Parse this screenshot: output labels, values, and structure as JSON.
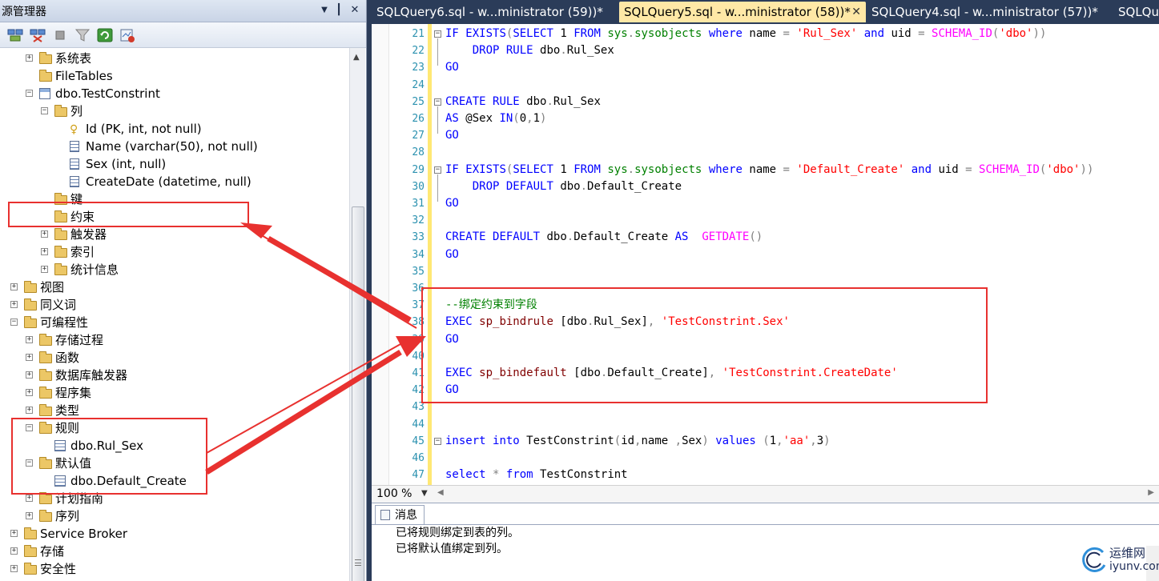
{
  "object_explorer": {
    "title": "源管理器",
    "controls": {
      "dropdown": "▼",
      "pin": "┃",
      "close": "✕"
    },
    "tree": [
      {
        "label": "系统表",
        "expander": "+",
        "icon": "folder"
      },
      {
        "label": "FileTables",
        "expander": "",
        "icon": "folder"
      },
      {
        "label": "dbo.TestConstrint",
        "expander": "−",
        "icon": "table"
      },
      {
        "label": "列",
        "expander": "−",
        "icon": "folder"
      },
      {
        "label": "Id (PK, int, not null)",
        "expander": "",
        "icon": "key"
      },
      {
        "label": "Name (varchar(50), not null)",
        "expander": "",
        "icon": "column"
      },
      {
        "label": "Sex (int, null)",
        "expander": "",
        "icon": "column"
      },
      {
        "label": "CreateDate (datetime, null)",
        "expander": "",
        "icon": "column"
      },
      {
        "label": "键",
        "expander": "",
        "icon": "folder"
      },
      {
        "label": "约束",
        "expander": "",
        "icon": "folder"
      },
      {
        "label": "触发器",
        "expander": "+",
        "icon": "folder"
      },
      {
        "label": "索引",
        "expander": "+",
        "icon": "folder"
      },
      {
        "label": "统计信息",
        "expander": "+",
        "icon": "folder"
      },
      {
        "label": "视图",
        "expander": "+",
        "icon": "folder"
      },
      {
        "label": "同义词",
        "expander": "+",
        "icon": "folder"
      },
      {
        "label": "可编程性",
        "expander": "−",
        "icon": "folder"
      },
      {
        "label": "存储过程",
        "expander": "+",
        "icon": "folder"
      },
      {
        "label": "函数",
        "expander": "+",
        "icon": "folder"
      },
      {
        "label": "数据库触发器",
        "expander": "+",
        "icon": "folder"
      },
      {
        "label": "程序集",
        "expander": "+",
        "icon": "folder"
      },
      {
        "label": "类型",
        "expander": "+",
        "icon": "folder"
      },
      {
        "label": "规则",
        "expander": "−",
        "icon": "folder"
      },
      {
        "label": "dbo.Rul_Sex",
        "expander": "",
        "icon": "rule"
      },
      {
        "label": "默认值",
        "expander": "−",
        "icon": "folder"
      },
      {
        "label": "dbo.Default_Create",
        "expander": "",
        "icon": "rule"
      },
      {
        "label": "计划指南",
        "expander": "+",
        "icon": "folder"
      },
      {
        "label": "序列",
        "expander": "+",
        "icon": "folder"
      },
      {
        "label": "Service Broker",
        "expander": "+",
        "icon": "folder"
      },
      {
        "label": "存储",
        "expander": "+",
        "icon": "folder"
      },
      {
        "label": "安全性",
        "expander": "+",
        "icon": "folder"
      }
    ]
  },
  "tabs": [
    {
      "label": "SQLQuery6.sql - w...ministrator (59))*",
      "active": false
    },
    {
      "label": "SQLQuery5.sql - w...ministrator (58))*",
      "active": true,
      "close": "✕"
    },
    {
      "label": "SQLQuery4.sql - w...ministrator (57))*",
      "active": false
    },
    {
      "label": "SQLQu",
      "active": false
    }
  ],
  "editor": {
    "line_numbers": [
      "21",
      "22",
      "23",
      "24",
      "25",
      "26",
      "27",
      "28",
      "29",
      "30",
      "31",
      "32",
      "33",
      "34",
      "35",
      "36",
      "37",
      "38",
      "39",
      "40",
      "41",
      "42",
      "43",
      "44",
      "45",
      "46",
      "47"
    ],
    "lines": [
      "IF EXISTS(SELECT 1 FROM sys.sysobjects where name = 'Rul_Sex' and uid = SCHEMA_ID('dbo'))",
      "    DROP RULE dbo.Rul_Sex",
      "GO",
      "",
      "CREATE RULE dbo.Rul_Sex",
      "AS @Sex IN(0,1)",
      "GO",
      "",
      "IF EXISTS(SELECT 1 FROM sys.sysobjects where name = 'Default_Create' and uid = SCHEMA_ID('dbo'))",
      "    DROP DEFAULT dbo.Default_Create",
      "GO",
      "",
      "CREATE DEFAULT dbo.Default_Create AS  GETDATE()",
      "GO",
      "",
      "",
      "--绑定约束到字段",
      "EXEC sp_bindrule [dbo.Rul_Sex], 'TestConstrint.Sex'",
      "GO",
      "",
      "EXEC sp_bindefault [dbo.Default_Create], 'TestConstrint.CreateDate'",
      "GO",
      "",
      "",
      "insert into TestConstrint(id,name ,Sex) values (1,'aa',3)",
      "",
      "select * from TestConstrint"
    ]
  },
  "zoom": {
    "value": "100 %",
    "arrow": "▼"
  },
  "messages": {
    "tab_label": "消息",
    "lines": [
      "已将规则绑定到表的列。",
      "已将默认值绑定到列。"
    ]
  },
  "watermark": {
    "cn": "运维网",
    "url": "iyunv.com"
  },
  "colors": {
    "tab_bar": "#2b3c59",
    "active_tab": "#ffe8a6",
    "annotation": "#e8312f",
    "keyword": "#0000ff",
    "string": "#ff0000",
    "comment": "#008000"
  }
}
